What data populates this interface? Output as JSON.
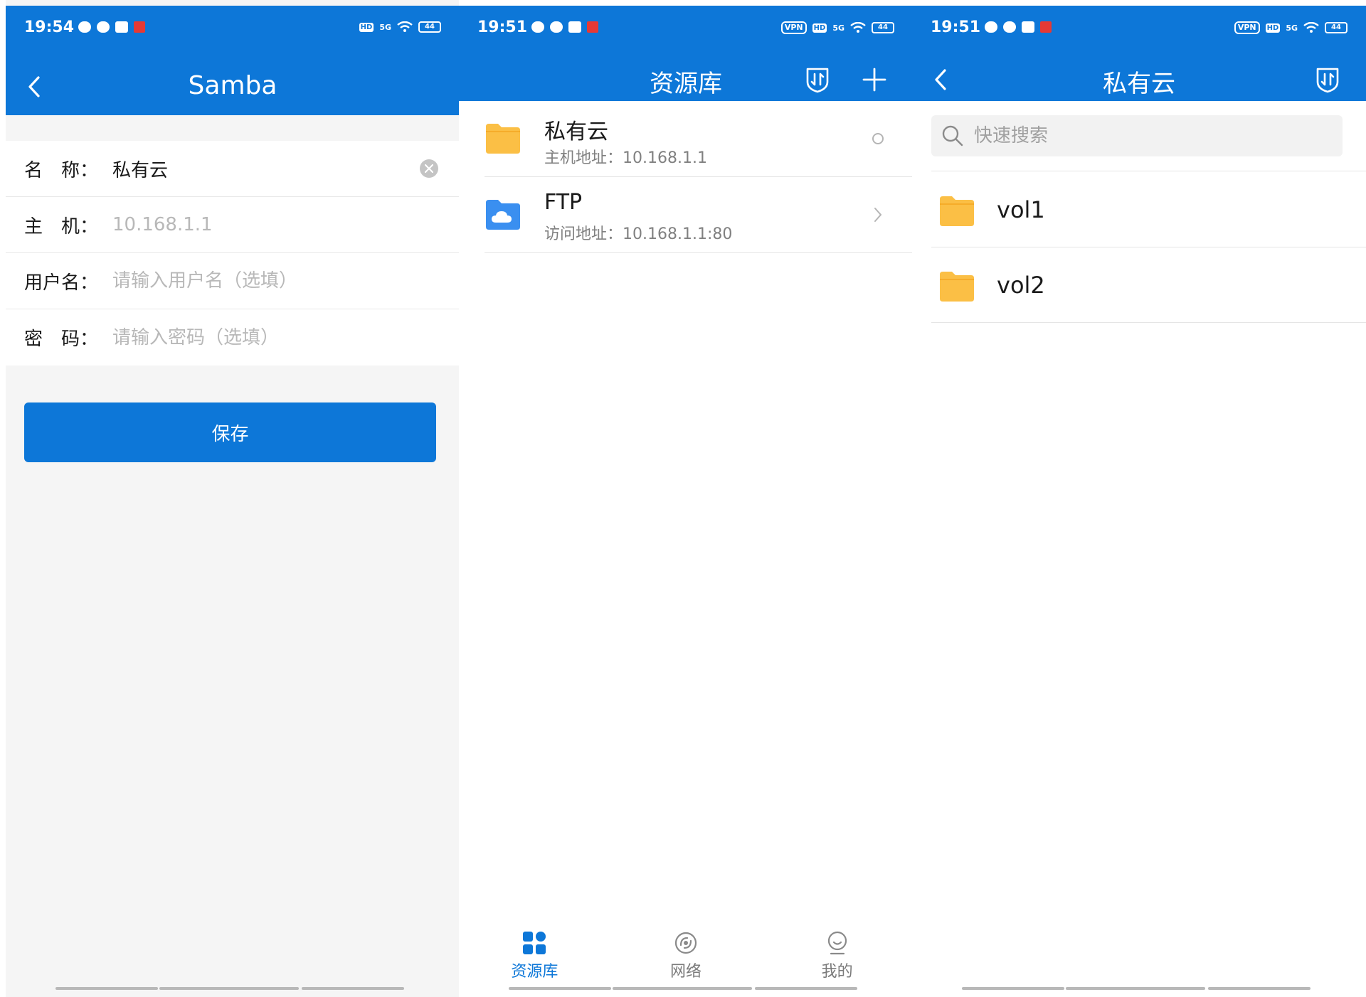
{
  "colors": {
    "primary": "#0d77d8",
    "folder": "#fbbf45",
    "cloud_folder": "#3a8ff0",
    "background": "#f5f5f5"
  },
  "screen1": {
    "status": {
      "time": "19:54",
      "signal": "5G",
      "battery": "44"
    },
    "title": "Samba",
    "back_icon": "chevron-left-icon",
    "form": {
      "name_label": "名　称：",
      "name_value": "私有云",
      "host_label": "主　机：",
      "host_placeholder": "10.168.1.1",
      "username_label": "用户名：",
      "username_placeholder": "请输入用户名（选填）",
      "password_label": "密　码：",
      "password_placeholder": "请输入密码（选填）"
    },
    "save_label": "保存"
  },
  "screen2": {
    "status": {
      "time": "19:51",
      "vpn": "VPN",
      "signal": "5G",
      "battery": "44"
    },
    "title": "资源库",
    "actions": [
      "transfer-icon",
      "plus-icon"
    ],
    "sources": [
      {
        "name": "私有云",
        "address": "主机地址：10.168.1.1",
        "icon": "folder-icon"
      },
      {
        "name": "FTP",
        "address": "访问地址：10.168.1.1:80",
        "icon": "cloud-folder-icon"
      }
    ],
    "tabs": [
      {
        "label": "资源库",
        "icon": "grid-icon",
        "active": true
      },
      {
        "label": "网络",
        "icon": "network-icon",
        "active": false
      },
      {
        "label": "我的",
        "icon": "profile-icon",
        "active": false
      }
    ]
  },
  "screen3": {
    "status": {
      "time": "19:51",
      "vpn": "VPN",
      "signal": "5G",
      "battery": "44"
    },
    "title": "私有云",
    "search_placeholder": "快速搜索",
    "volumes": [
      {
        "name": "vol1"
      },
      {
        "name": "vol2"
      }
    ]
  }
}
